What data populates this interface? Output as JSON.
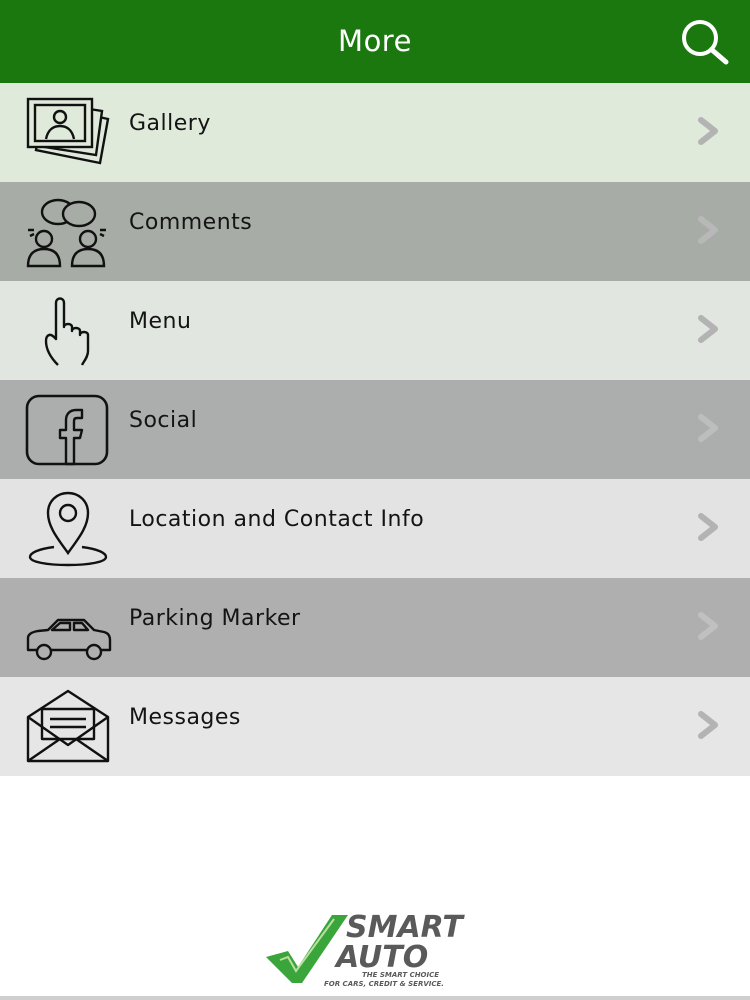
{
  "header": {
    "title": "More",
    "background": "#1b780f",
    "search_icon": "search-icon"
  },
  "menu": {
    "items": [
      {
        "label": "Gallery",
        "icon": "gallery-icon",
        "background": "#dfeadb"
      },
      {
        "label": "Comments",
        "icon": "comments-icon",
        "background": "#a7aca6"
      },
      {
        "label": "Menu",
        "icon": "pointing-hand-icon",
        "background": "#e1e6e0"
      },
      {
        "label": "Social",
        "icon": "facebook-icon",
        "background": "#acadad"
      },
      {
        "label": "Location and Contact Info",
        "icon": "location-pin-icon",
        "background": "#e4e3e4"
      },
      {
        "label": "Parking Marker",
        "icon": "car-icon",
        "background": "#b0afb0"
      },
      {
        "label": "Messages",
        "icon": "envelope-icon",
        "background": "#e6e6e6"
      }
    ],
    "chevron_icon": "chevron-right-icon"
  },
  "logo": {
    "line1": "SMART",
    "line2": "AUTO",
    "tagline1": "THE SMART CHOICE",
    "tagline2": "FOR CARS, CREDIT & SERVICE.",
    "accent": "#3aa53a"
  }
}
